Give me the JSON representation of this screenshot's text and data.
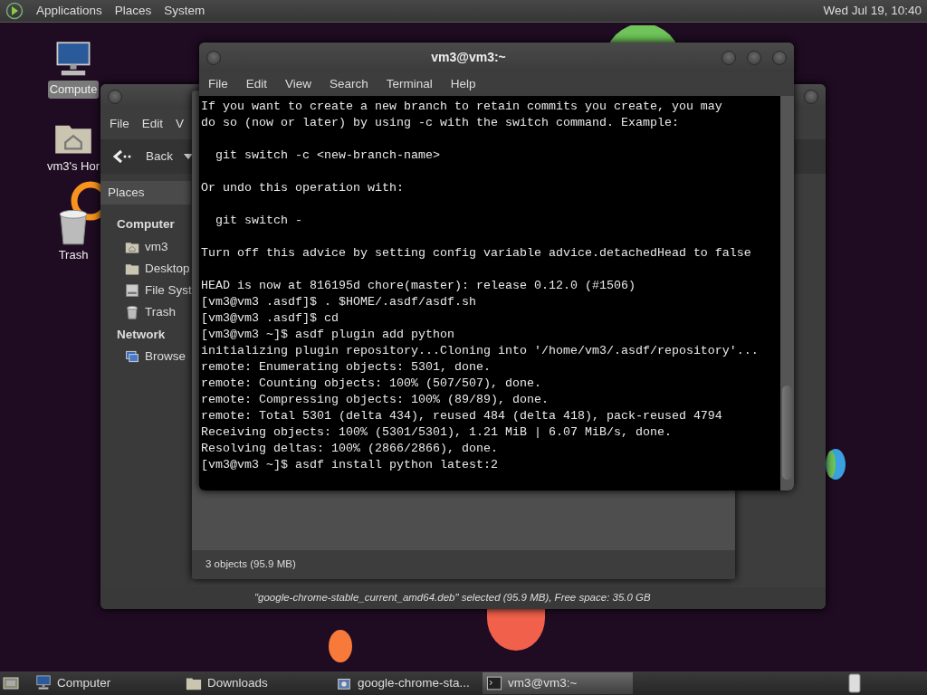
{
  "top_panel": {
    "menus": [
      "Applications",
      "Places",
      "System"
    ],
    "clock": "Wed Jul 19, 10:40"
  },
  "desktop_icons": [
    {
      "kind": "computer",
      "label": "Compute",
      "selected": true
    },
    {
      "kind": "home",
      "label": "vm3's Hor",
      "selected": false
    },
    {
      "kind": "trash",
      "label": "Trash",
      "selected": false
    }
  ],
  "file_manager": {
    "menus": [
      "File",
      "Edit",
      "V"
    ],
    "back_button": "Back",
    "sidebar": {
      "header": "Places",
      "sections": [
        {
          "title": "Computer",
          "items": [
            {
              "kind": "home",
              "label": "vm3"
            },
            {
              "kind": "folder",
              "label": "Desktop"
            },
            {
              "kind": "drive",
              "label": "File Syst"
            },
            {
              "kind": "trash",
              "label": "Trash"
            }
          ]
        },
        {
          "title": "Network",
          "items": [
            {
              "kind": "network",
              "label": "Browse"
            }
          ]
        }
      ]
    },
    "status": "\"google-chrome-stable_current_amd64.deb\" selected (95.9 MB), Free space: 35.0 GB"
  },
  "downloads_window": {
    "status": "3 objects (95.9 MB)"
  },
  "terminal": {
    "title": "vm3@vm3:~",
    "menus": [
      "File",
      "Edit",
      "View",
      "Search",
      "Terminal",
      "Help"
    ],
    "blocks": [
      [
        "If you want to create a new branch to retain commits you create, you may",
        "do so (now or later) by using -c with the switch command. Example:"
      ],
      [
        "  git switch -c <new-branch-name>"
      ],
      [
        "Or undo this operation with:"
      ],
      [
        "  git switch -"
      ],
      [
        "Turn off this advice by setting config variable advice.detachedHead to false"
      ],
      [
        "HEAD is now at 816195d chore(master): release 0.12.0 (#1506)",
        "[vm3@vm3 .asdf]$ . $HOME/.asdf/asdf.sh",
        "[vm3@vm3 .asdf]$ cd",
        "[vm3@vm3 ~]$ asdf plugin add python",
        "initializing plugin repository...Cloning into '/home/vm3/.asdf/repository'...",
        "remote: Enumerating objects: 5301, done.",
        "remote: Counting objects: 100% (507/507), done.",
        "remote: Compressing objects: 100% (89/89), done.",
        "remote: Total 5301 (delta 434), reused 484 (delta 418), pack-reused 4794",
        "Receiving objects: 100% (5301/5301), 1.21 MiB | 6.07 MiB/s, done.",
        "Resolving deltas: 100% (2866/2866), done.",
        "[vm3@vm3 ~]$ asdf install python latest:2"
      ]
    ]
  },
  "taskbar": {
    "items": [
      {
        "kind": "computer",
        "label": "Computer",
        "selected": false
      },
      {
        "kind": "folder",
        "label": "Downloads",
        "selected": false
      },
      {
        "kind": "package",
        "label": "google-chrome-sta...",
        "selected": false
      },
      {
        "kind": "terminal",
        "label": "vm3@vm3:~",
        "selected": true
      }
    ]
  }
}
